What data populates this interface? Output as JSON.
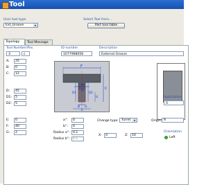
{
  "window": {
    "title": "Tool"
  },
  "header": {
    "user_tool_type_label": "User tool type",
    "user_tool_type_value": "Ext_Groove",
    "select_tool_label": "Select Tool from...",
    "part_tool_table_button": "Part tool table"
  },
  "tabs": [
    {
      "label": "Topology",
      "active": true
    },
    {
      "label": "Tool Message",
      "active": false
    }
  ],
  "info": {
    "tool_number_label": "Tool Number/Pos.",
    "tool_number": "3",
    "tool_pos": "c",
    "id_label": "ID number",
    "id_value": "1077968056",
    "description_label": "Description",
    "description_value": "External Groove"
  },
  "params": [
    {
      "name": "A:",
      "value": "25",
      "disabled": false
    },
    {
      "name": "B:",
      "value": "0",
      "disabled": false
    },
    {
      "name": "C:",
      "value": "12",
      "disabled": false
    },
    {
      "name": "D:",
      "value": "45",
      "disabled": false
    },
    {
      "name": "D1:",
      "value": "5",
      "disabled": false
    },
    {
      "name": "D2:",
      "value": "5",
      "disabled": false
    },
    {
      "name": "E:",
      "value": "0",
      "disabled": false
    },
    {
      "name": "F:",
      "value": "40",
      "disabled": false
    },
    {
      "name": "G:",
      "value": "2",
      "disabled": false
    }
  ],
  "drawing_labels": {
    "F": "F",
    "A": "A",
    "D": "D",
    "C": "C",
    "D1": "D1",
    "D2": "D2",
    "B": "B",
    "G": "G",
    "E": "E",
    "U": "U"
  },
  "angles": {
    "a_label": "a°:",
    "a_value": "0",
    "b_label": "b°:",
    "b_value": "0",
    "radius_a_label": "Radius a°:",
    "radius_a_value": "0.1",
    "radius_b_label": "Radius b°:",
    "radius_b_value": "0.1"
  },
  "change_type": {
    "label": "Change type:",
    "value": "Turret"
  },
  "coords": {
    "x_label": "X:",
    "x_value": "0",
    "z_label": "Z:",
    "z_value": "10"
  },
  "origin": {
    "label": "Origin:",
    "value": "R"
  },
  "application": {
    "label": "Application",
    "value": "0"
  },
  "orientation": {
    "label": "Orientation",
    "option": "Left"
  },
  "colors": {
    "titlebar": "#1a5cc0",
    "label_blue": "#2a55a8",
    "drawing_bg": "#c8ccd2",
    "tool_fill": "#5a5e66",
    "dim_blue": "#1030e0"
  }
}
